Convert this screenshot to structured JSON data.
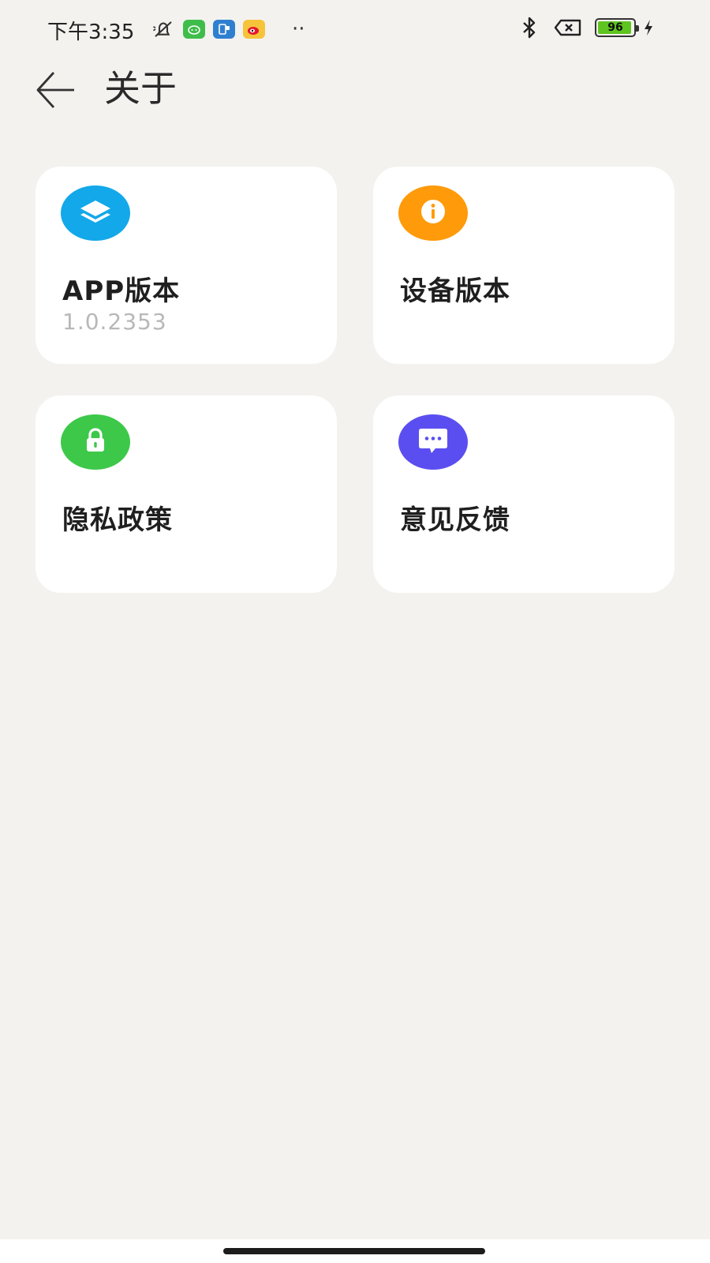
{
  "status_bar": {
    "time": "下午3:35",
    "more": "··",
    "battery_level": "96",
    "battery_fraction": 0.96,
    "battery_color": "#5ec41f",
    "icons": [
      "mute-icon",
      "wechat-like-app-icon",
      "phone-app-icon",
      "weibo-icon",
      "bluetooth-icon",
      "no-sim-icon",
      "battery-icon",
      "charging-icon"
    ]
  },
  "header": {
    "title": "关于",
    "back_icon": "arrow-left-icon"
  },
  "cards": [
    {
      "title": "APP版本",
      "subtitle": "1.0.2353",
      "icon": "layers-icon",
      "color": "#12a8ea"
    },
    {
      "title": "设备版本",
      "subtitle": "",
      "icon": "info-icon",
      "color": "#ff9a0a"
    },
    {
      "title": "隐私政策",
      "subtitle": "",
      "icon": "lock-icon",
      "color": "#3dc84a"
    },
    {
      "title": "意见反馈",
      "subtitle": "",
      "icon": "message-icon",
      "color": "#5b4ef0"
    }
  ]
}
